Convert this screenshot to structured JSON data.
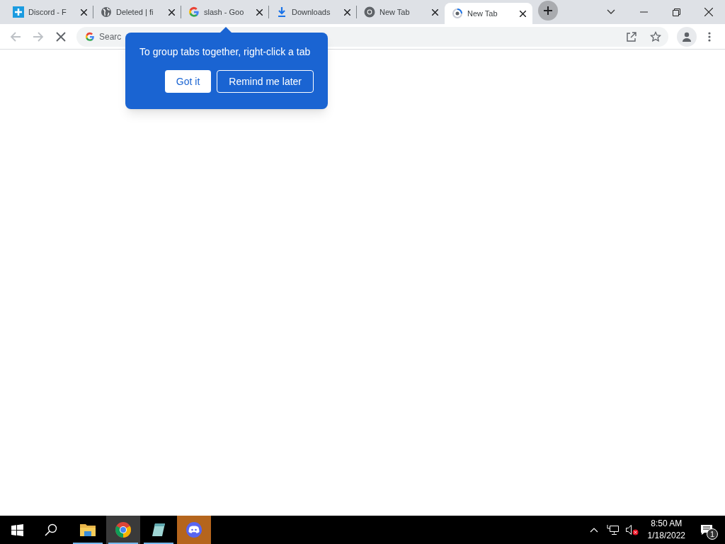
{
  "tabs": [
    {
      "title": "Discord - F",
      "kind": "plus",
      "selected": false
    },
    {
      "title": "Deleted | fi",
      "kind": "globe",
      "selected": false
    },
    {
      "title": "slash - Goo",
      "kind": "google",
      "selected": false
    },
    {
      "title": "Downloads",
      "kind": "download",
      "selected": false
    },
    {
      "title": "New Tab",
      "kind": "chrome",
      "selected": false
    },
    {
      "title": "New Tab",
      "kind": "loading",
      "selected": true
    }
  ],
  "address_bar": {
    "placeholder": "Searc"
  },
  "bubble": {
    "message": "To group tabs together, right-click a tab",
    "buttons": [
      {
        "label": "Got it",
        "kind": "primary"
      },
      {
        "label": "Remind me later",
        "kind": "outline"
      }
    ]
  },
  "taskbar": {
    "apps": [
      {
        "kind": "folder",
        "running": true,
        "selected": false,
        "attention": false
      },
      {
        "kind": "browser",
        "running": true,
        "selected": true,
        "attention": false
      },
      {
        "kind": "notepad",
        "running": true,
        "selected": false,
        "attention": false
      },
      {
        "kind": "chat",
        "running": false,
        "selected": false,
        "attention": true
      }
    ],
    "time": "8:50 AM",
    "date": "1/18/2022",
    "notifications": "1"
  }
}
